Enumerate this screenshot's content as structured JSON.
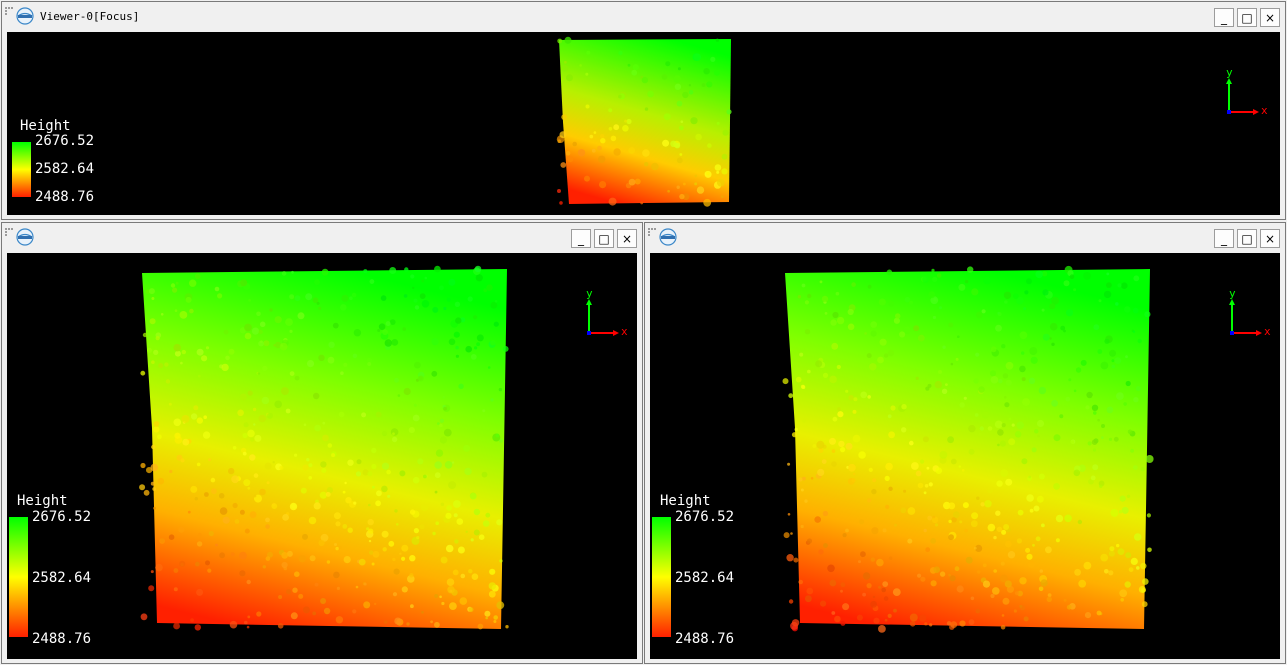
{
  "viewers": [
    {
      "id": "top",
      "title": "Viewer-0[Focus]",
      "legend": {
        "title": "Height",
        "max": "2676.52",
        "mid": "2582.64",
        "min": "2488.76"
      },
      "axis": {
        "x": "x",
        "y": "y"
      }
    },
    {
      "id": "bottom-left",
      "title": "",
      "legend": {
        "title": "Height",
        "max": "2676.52",
        "mid": "2582.64",
        "min": "2488.76"
      },
      "axis": {
        "x": "x",
        "y": "y"
      }
    },
    {
      "id": "bottom-right",
      "title": "",
      "legend": {
        "title": "Height",
        "max": "2676.52",
        "mid": "2582.64",
        "min": "2488.76"
      },
      "axis": {
        "x": "x",
        "y": "y"
      }
    }
  ],
  "window_controls": {
    "minimize": "_",
    "restore": "□",
    "close": "×"
  },
  "colors": {
    "high": "#00ff00",
    "mid": "#ffff00",
    "low": "#ff2000",
    "background": "#000000"
  },
  "icons": {
    "logo": "lidar360-logo-icon",
    "grip": "drag-grip-icon"
  }
}
